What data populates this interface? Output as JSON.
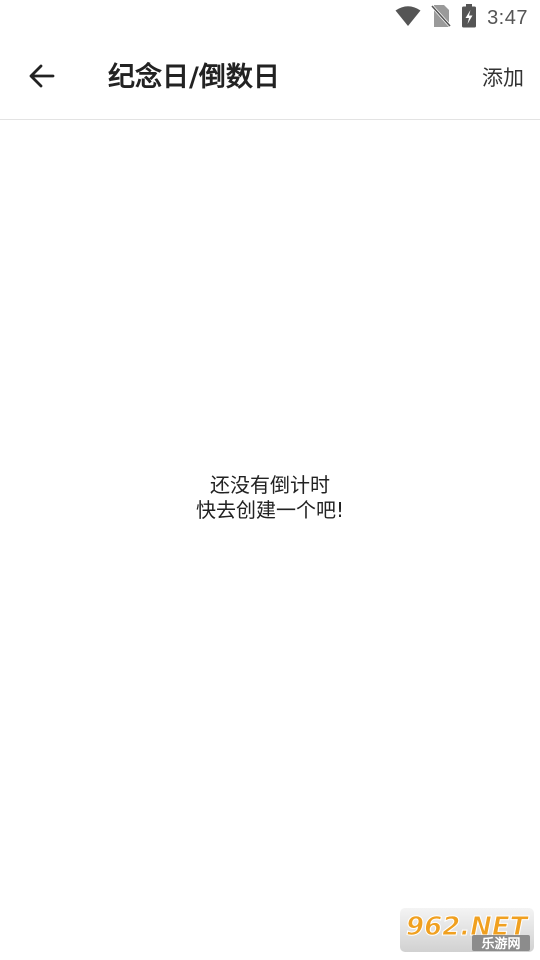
{
  "status_bar": {
    "time": "3:47",
    "icons": [
      "wifi-icon",
      "no-sim-icon",
      "battery-charging-icon"
    ]
  },
  "app_bar": {
    "back_icon": "arrow-left-icon",
    "title": "纪念日/倒数日",
    "add_label": "添加"
  },
  "empty_state": {
    "line1": "还没有倒计时",
    "line2": "快去创建一个吧!"
  },
  "watermark": {
    "logo_text": "962.NET",
    "sub_text": "乐游网"
  },
  "colors": {
    "background": "#ffffff",
    "text": "#222222",
    "divider": "#e3e3e3",
    "status_icon": "#555555",
    "watermark_orange": "#f0a020"
  }
}
